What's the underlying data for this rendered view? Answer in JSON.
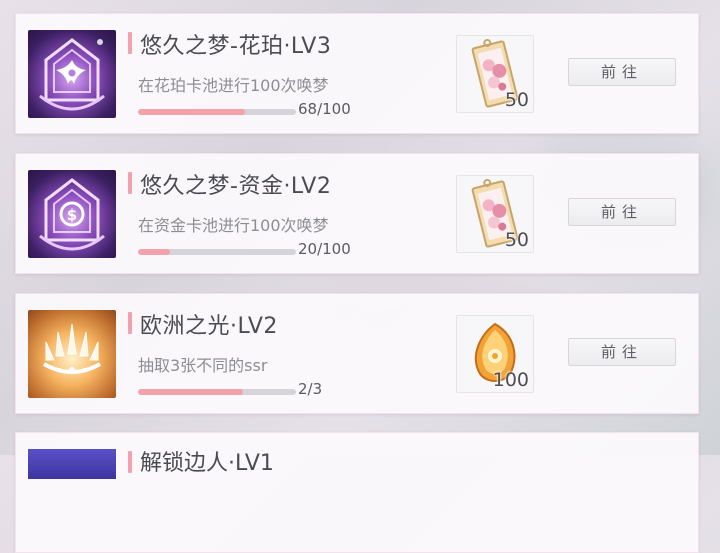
{
  "colors": {
    "progress_fill": "#f4a2aa",
    "title_accent": "#f2a1ad",
    "icon_purple": "#8e4fc0",
    "icon_gold": "#f6b460",
    "partial_icon": "#4b44b8"
  },
  "achievements": [
    {
      "title": "悠久之梦-花珀·LV3",
      "desc": "在花珀卡池进行100次唤梦",
      "progress_text": "68/100",
      "progress": 0.68,
      "icon": "flower-emblem-icon",
      "reward_icon": "dream-ticket-icon",
      "reward_count": "50",
      "button_label": "前往"
    },
    {
      "title": "悠久之梦-资金·LV2",
      "desc": "在资金卡池进行100次唤梦",
      "progress_text": "20/100",
      "progress": 0.2,
      "icon": "coin-emblem-icon",
      "reward_icon": "dream-ticket-icon",
      "reward_count": "50",
      "button_label": "前往"
    },
    {
      "title": "欧洲之光·LV2",
      "desc": "抽取3张不同的ssr",
      "progress_text": "2/3",
      "progress": 0.6667,
      "icon": "crown-emblem-icon",
      "reward_icon": "amber-crystal-icon",
      "reward_count": "100",
      "button_label": "前往"
    }
  ],
  "partial": {
    "title": "解锁边人·LV1",
    "icon": "partial-emblem-icon"
  }
}
